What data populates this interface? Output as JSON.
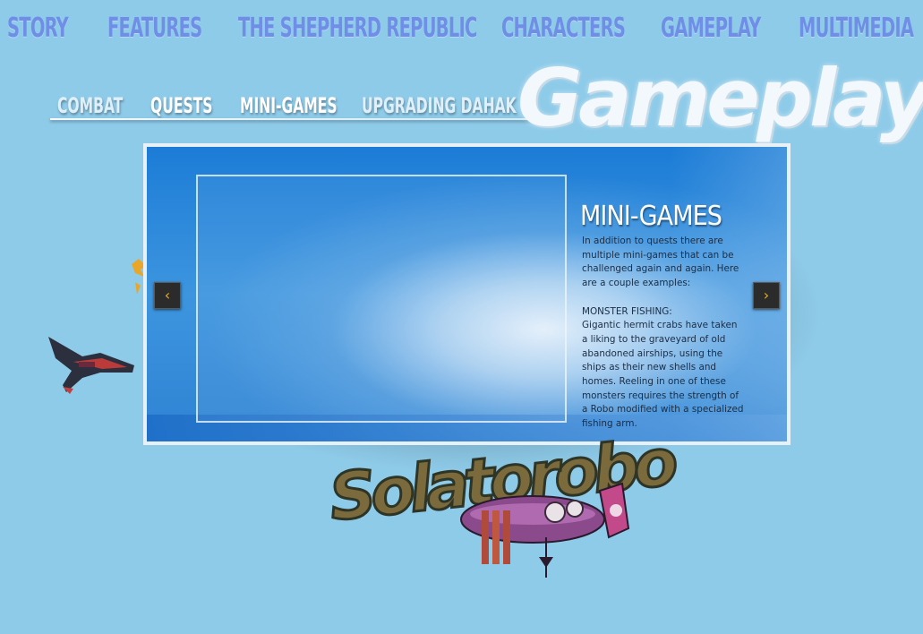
{
  "nav": {
    "items": [
      {
        "label": "STORY"
      },
      {
        "label": "FEATURES"
      },
      {
        "label": "THE SHEPHERD REPUBLIC"
      },
      {
        "label": "CHARACTERS"
      },
      {
        "label": "GAMEPLAY"
      },
      {
        "label": "MULTIMEDIA"
      }
    ]
  },
  "subnav": {
    "items": [
      {
        "label": "COMBAT"
      },
      {
        "label": "QUESTS"
      },
      {
        "label": "MINI-GAMES"
      },
      {
        "label": "UPGRADING DAHAK"
      }
    ],
    "active": "MINI-GAMES"
  },
  "page": {
    "title": "Gameplay"
  },
  "slide": {
    "title": "MINI-GAMES",
    "intro": "In addition to quests there are multiple mini-games that can be challenged again and again. Here are a couple examples:",
    "subheading": "MONSTER FISHING:",
    "body": "Gigantic hermit crabs have taken a liking to the graveyard of old abandoned airships, using the ships as their new shells and homes. Reeling in one of these monsters requires the strength of a Robo modified with a specialized fishing arm."
  },
  "controls": {
    "prev_glyph": "‹",
    "next_glyph": "›"
  },
  "logo": {
    "text": "Solatorobo"
  },
  "colors": {
    "background": "#8ecbe9",
    "nav_text": "#6f8fe6",
    "panel_blue": "#1c7cd6",
    "arrow": "#e6b020"
  }
}
